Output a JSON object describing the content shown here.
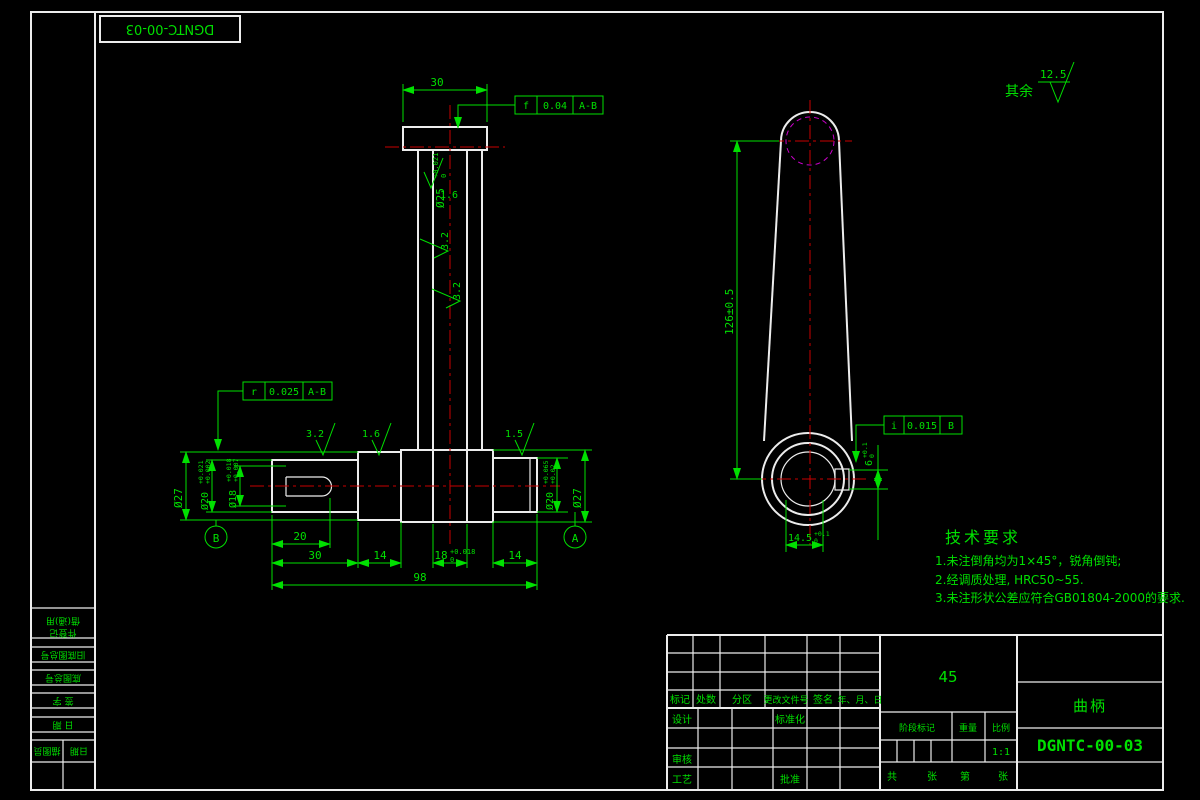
{
  "sheet": {
    "code": "DGNTC-00-03",
    "surface_note": {
      "prefix": "其余",
      "value": "12.5"
    }
  },
  "front_view": {
    "dim_30": "30",
    "frame_parallel": {
      "sym": "f",
      "tol": "0.04",
      "datum": "A-B"
    },
    "frame_runout": {
      "sym": "r",
      "tol": "0.025",
      "datum": "A-B"
    },
    "dia25": {
      "main": "Ø25",
      "tol_top": "+0.021",
      "tol_bot": "0"
    },
    "dia27_left": "Ø27",
    "dia20_left": {
      "main": "Ø20",
      "tol_top": "+0.021",
      "tol_bot": "+0.002"
    },
    "dia18_left": {
      "main": "Ø18",
      "tol_top": "+0.018",
      "tol_bot": "+0.007"
    },
    "dia20_right": {
      "main": "Ø20",
      "tol_top": "+0.065",
      "tol_bot": "+0.02"
    },
    "dia27_right": "Ø27",
    "dim_20": "20",
    "dim_30b": "30",
    "dim_14a": "14",
    "dim_18": {
      "main": "18",
      "tol_top": "+0.018",
      "tol_bot": "0"
    },
    "dim_14b": "14",
    "dim_98": "98",
    "datum_a": "A",
    "datum_b": "B",
    "roughness": {
      "r1": "1.6",
      "r2": "3.2",
      "r3": "3.2",
      "r4": "3.2",
      "r5": "1.6",
      "r6": "1.5"
    }
  },
  "side_view": {
    "dim_126": "126±0.5",
    "dim_6": {
      "main": "6",
      "tol_top": "+0.1",
      "tol_bot": "0"
    },
    "dim_14_5": {
      "main": "14.5",
      "tol_top": "+0.1",
      "tol_bot": "0"
    },
    "frame_i": {
      "sym": "i",
      "tol": "0.015",
      "datum": "B"
    }
  },
  "tech_req": {
    "title": "技术要求",
    "items": [
      "1.未注倒角均为1×45°，锐角倒钝;",
      "2.经调质处理, HRC50~55.",
      "3.未注形状公差应符合GB01804-2000的要求."
    ]
  },
  "title_block": {
    "rev_headers": [
      "标记",
      "处数",
      "分区",
      "更改文件号",
      "签名",
      "年、月、日"
    ],
    "roles": {
      "design": "设计",
      "standard": "标准化",
      "check": "审核",
      "process": "工艺",
      "approve": "批准"
    },
    "material": "45",
    "stage_label": "阶段标记",
    "weight_label": "重量",
    "scale_label": "比例",
    "scale_value": "1:1",
    "sheets": {
      "total_label": "共",
      "sheet_word1": "张",
      "page_label": "第",
      "sheet_word2": "张"
    },
    "part_name": "曲柄",
    "drawing_no": "DGNTC-00-03"
  },
  "binding_table": {
    "row1a": "借(通)用",
    "row1b": "件登记",
    "row2": "旧底图总号",
    "row3": "底图总号",
    "row4": "签  字",
    "row5": "日  期",
    "row6a": "描图员",
    "row6b": "日期"
  }
}
